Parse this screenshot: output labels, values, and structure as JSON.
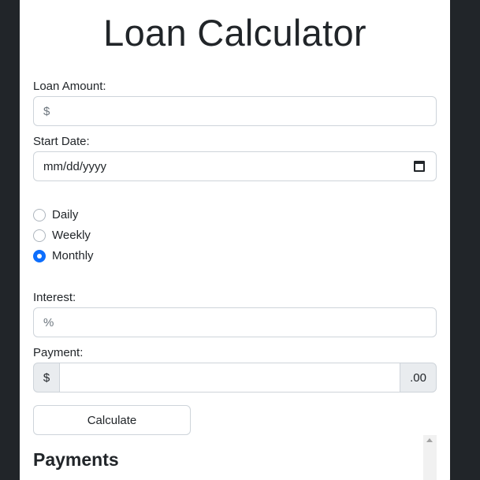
{
  "page": {
    "title": "Loan Calculator"
  },
  "loan_amount": {
    "label": "Loan Amount:",
    "placeholder": "$",
    "value": ""
  },
  "start_date": {
    "label": "Start Date:",
    "placeholder": "mm/dd/yyyy",
    "icon": "calendar-icon"
  },
  "frequency": {
    "options": [
      "Daily",
      "Weekly",
      "Monthly"
    ],
    "selected": "Monthly"
  },
  "interest": {
    "label": "Interest:",
    "placeholder": "%",
    "value": ""
  },
  "payment": {
    "label": "Payment:",
    "prefix": "$",
    "suffix": ".00",
    "value": ""
  },
  "calculate_button": {
    "label": "Calculate"
  },
  "payments_section": {
    "title": "Payments"
  },
  "colors": {
    "background": "#212529",
    "card": "#ffffff",
    "accent": "#0d6efd",
    "addon": "#e9ecef"
  }
}
